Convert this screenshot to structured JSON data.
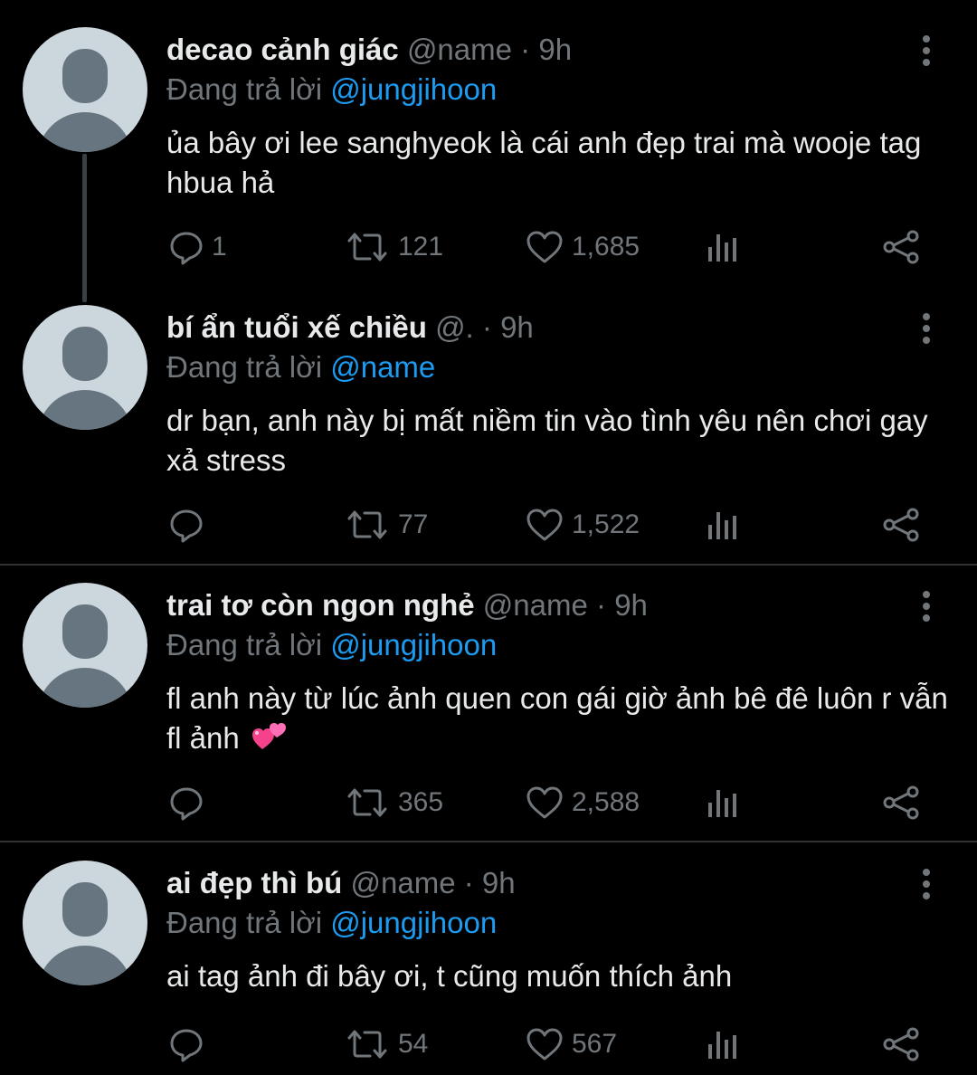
{
  "tweets": [
    {
      "display_name": "decao cảnh giác",
      "handle": "@name",
      "separator": "·",
      "time": "9h",
      "replying_label": "Đang trả lời",
      "replying_to": "@jungjihoon",
      "text": "ủa bây ơi lee sanghyeok là cái anh đẹp trai mà wooje tag hbua hả",
      "reply_count": "1",
      "retweet_count": "121",
      "like_count": "1,685"
    },
    {
      "display_name": "bí ẩn tuổi xế chiều",
      "handle": "@.",
      "separator": "·",
      "time": "9h",
      "replying_label": "Đang trả lời",
      "replying_to": "@name",
      "text": "dr bạn, anh này bị mất niềm tin vào tình yêu nên chơi gay xả stress",
      "reply_count": "",
      "retweet_count": "77",
      "like_count": "1,522"
    },
    {
      "display_name": "trai tơ còn ngon nghẻ",
      "handle": "@name",
      "separator": "·",
      "time": "9h",
      "replying_label": "Đang trả lời",
      "replying_to": "@jungjihoon",
      "text": "fl anh này từ lúc ảnh quen con gái giờ ảnh bê đê luôn r vẫn fl ảnh",
      "emoji": "two-hearts",
      "reply_count": "",
      "retweet_count": "365",
      "like_count": "2,588"
    },
    {
      "display_name": "ai đẹp thì bú",
      "handle": "@name",
      "separator": "·",
      "time": "9h",
      "replying_label": "Đang trả lời",
      "replying_to": "@jungjihoon",
      "text": "ai tag ảnh đi bây ơi, t cũng muốn thích ảnh",
      "reply_count": "",
      "retweet_count": "54",
      "like_count": "567"
    }
  ],
  "icons": {
    "reply": "reply-icon",
    "retweet": "retweet-icon",
    "like": "heart-icon",
    "views": "views-icon",
    "share": "share-icon",
    "more": "more-vertical-icon"
  },
  "colors": {
    "background": "#000000",
    "text_primary": "#e7e9ea",
    "text_secondary": "#71767b",
    "mention": "#1d9bf0",
    "divider": "#2f3336",
    "thread_line": "#3b4045",
    "avatar_bg": "#ccd6dd",
    "avatar_fg": "#66757f"
  }
}
